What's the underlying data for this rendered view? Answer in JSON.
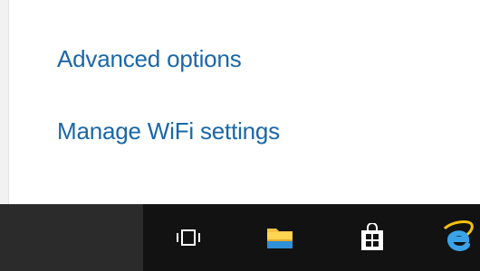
{
  "flyout": {
    "advanced_options_label": "Advanced options",
    "manage_wifi_label": "Manage WiFi settings"
  },
  "taskbar": {
    "icons": [
      "task-view-icon",
      "file-explorer-icon",
      "store-icon",
      "internet-explorer-icon"
    ]
  },
  "colors": {
    "link": "#1a67a8",
    "taskbar": "#121212",
    "taskbar_start_area": "#2b2b2b"
  }
}
